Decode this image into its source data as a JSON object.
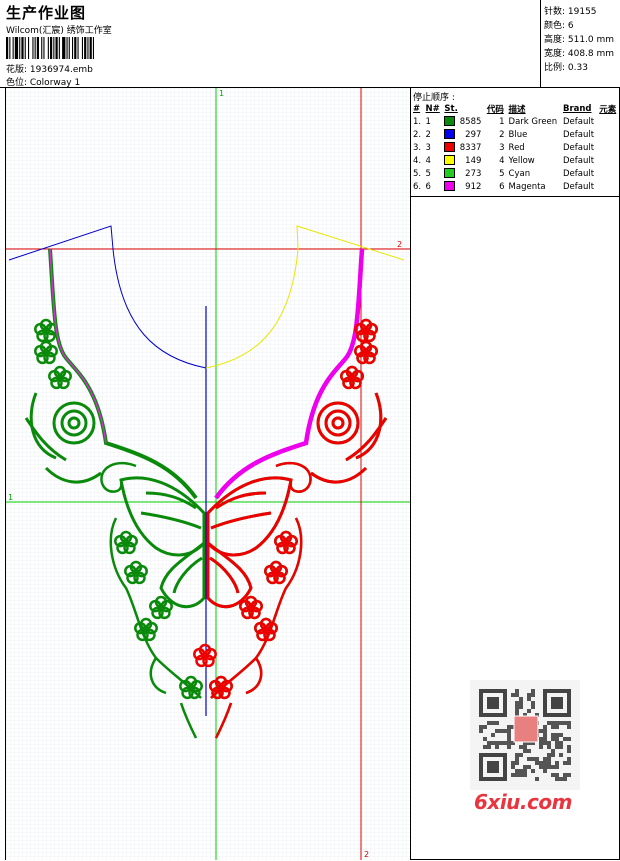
{
  "header": {
    "title": "生产作业图",
    "subtitle": "Wilcom(汇宸) 绣饰工作室",
    "design_line": "花版:  1936974.emb",
    "colorway_line": "色位:  Colorway 1"
  },
  "stats": {
    "stitches": "针数:  19155",
    "colors": "颜色:  6",
    "height": "高度:  511.0 mm",
    "width": "宽度:  408.8 mm",
    "scale": "比例:  0.33"
  },
  "stop_sequence": {
    "title": "停止顺序 :",
    "headers": [
      "#",
      "N#",
      "St.",
      "代码",
      "描述",
      "Brand",
      "元素"
    ],
    "rows": [
      {
        "idx": "1.",
        "n": "1",
        "stitches": "8585",
        "code": "1",
        "desc": "Dark Green",
        "brand": "Default",
        "color": "#0a8a0a"
      },
      {
        "idx": "2.",
        "n": "2",
        "stitches": "297",
        "code": "2",
        "desc": "Blue",
        "brand": "Default",
        "color": "#0000ee"
      },
      {
        "idx": "3.",
        "n": "3",
        "stitches": "8337",
        "code": "3",
        "desc": "Red",
        "brand": "Default",
        "color": "#ee0000"
      },
      {
        "idx": "4.",
        "n": "4",
        "stitches": "149",
        "code": "4",
        "desc": "Yellow",
        "brand": "Default",
        "color": "#ffff00"
      },
      {
        "idx": "5.",
        "n": "5",
        "stitches": "273",
        "code": "5",
        "desc": "Cyan",
        "brand": "Default",
        "color": "#22cc22"
      },
      {
        "idx": "6.",
        "n": "6",
        "stitches": "912",
        "code": "6",
        "desc": "Magenta",
        "brand": "Default",
        "color": "#ee00ee"
      }
    ]
  },
  "canvas": {
    "guide_labels": {
      "green_top": "1",
      "green_left": "1",
      "red_right": "2",
      "red_bottom": "2"
    },
    "guide_colors": {
      "green": "#00cc00",
      "red": "#dd0000"
    }
  },
  "watermark": {
    "text": "6xiu.com",
    "color": "#e8353f"
  }
}
